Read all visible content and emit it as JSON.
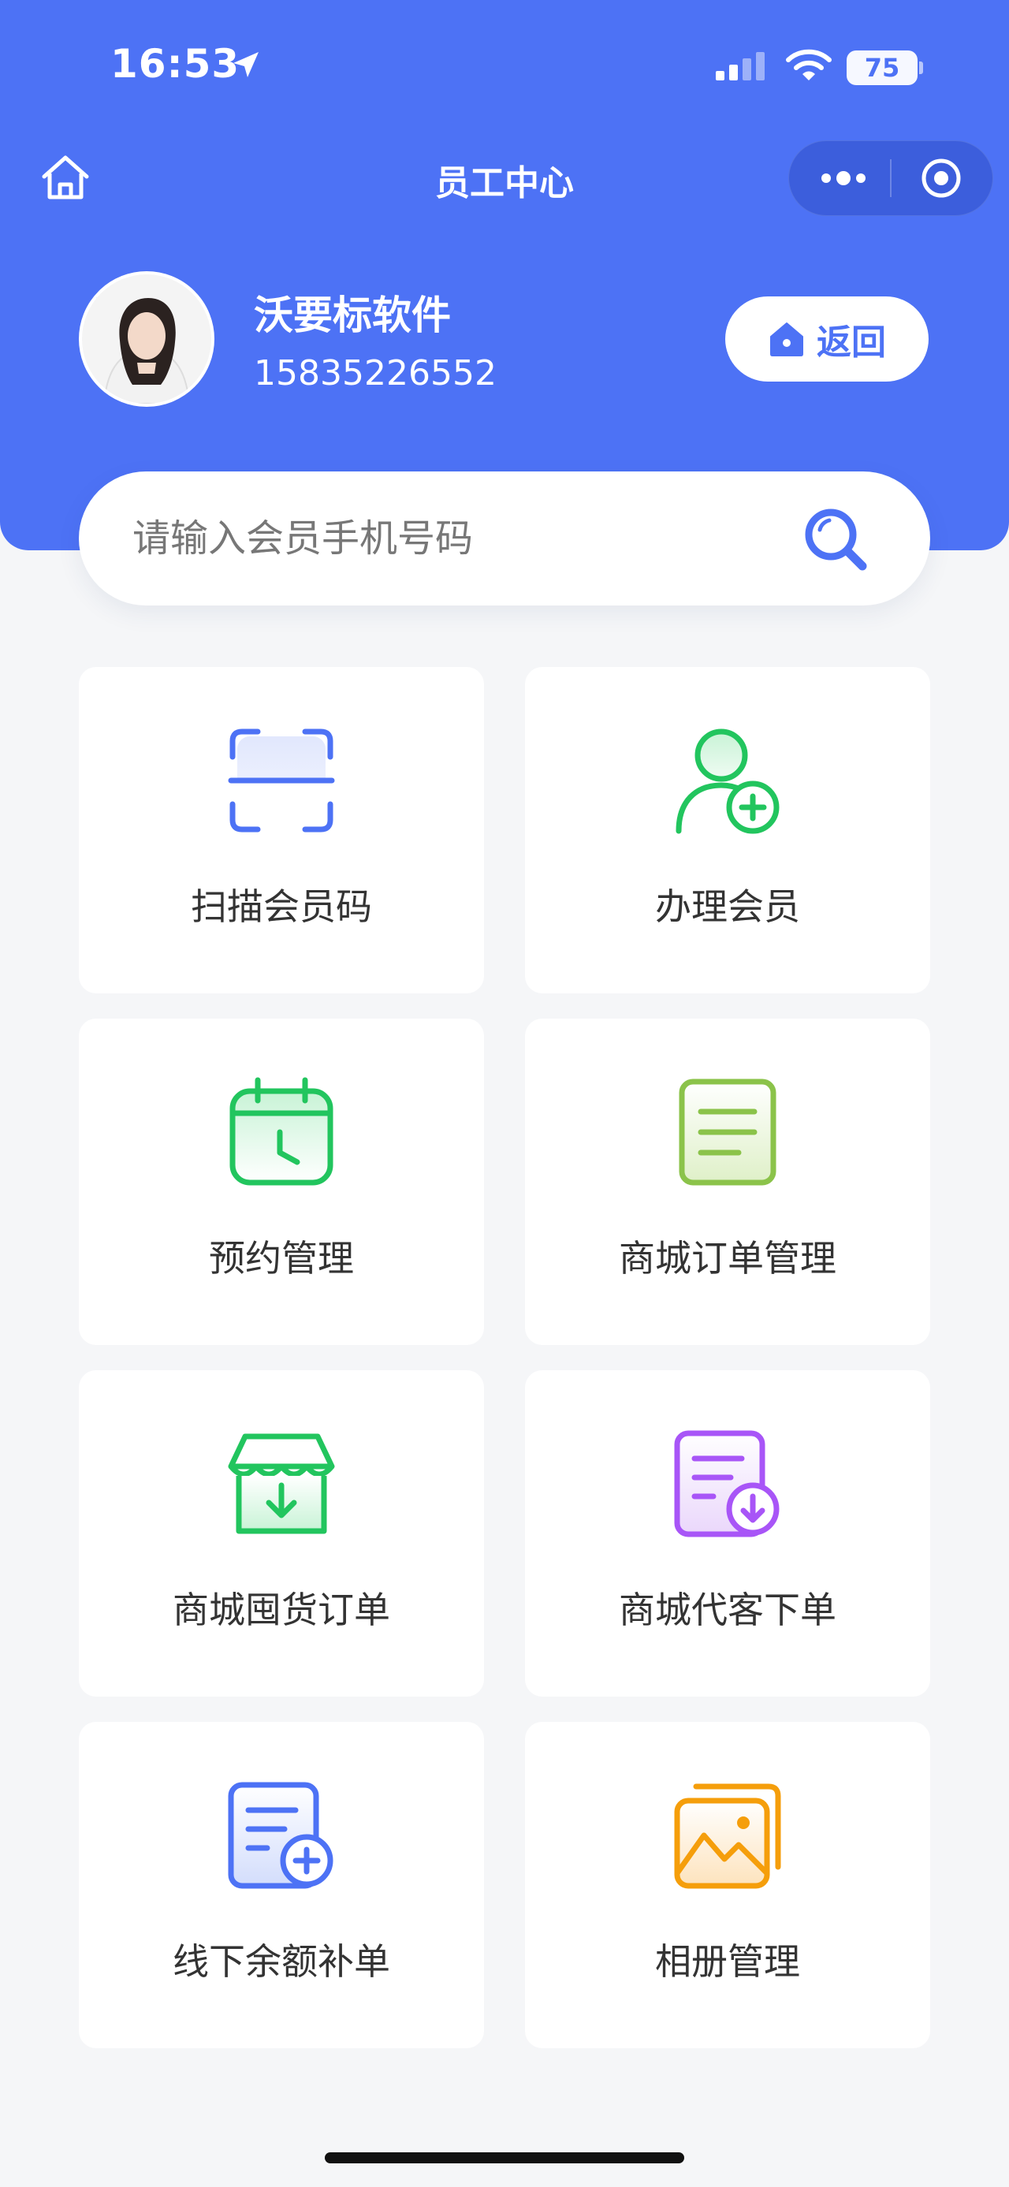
{
  "status_bar": {
    "time": "16:53",
    "battery": "75"
  },
  "nav": {
    "title": "员工中心"
  },
  "profile": {
    "name": "沃要标软件",
    "phone": "15835226552",
    "avatar_text": "沃要标软件"
  },
  "back_button": {
    "label": "返回"
  },
  "search": {
    "placeholder": "请输入会员手机号码"
  },
  "menu": [
    {
      "label": "扫描会员码",
      "icon": "scan-icon"
    },
    {
      "label": "办理会员",
      "icon": "add-member-icon"
    },
    {
      "label": "预约管理",
      "icon": "calendar-clock-icon"
    },
    {
      "label": "商城订单管理",
      "icon": "document-icon"
    },
    {
      "label": "商城囤货订单",
      "icon": "store-download-icon"
    },
    {
      "label": "商城代客下单",
      "icon": "document-download-icon"
    },
    {
      "label": "线下余额补单",
      "icon": "document-add-icon"
    },
    {
      "label": "相册管理",
      "icon": "album-icon"
    }
  ],
  "colors": {
    "primary": "#4d72f5",
    "green": "#22c55e",
    "lime": "#8bc34a",
    "purple": "#a855f7",
    "orange": "#f59e0b"
  }
}
